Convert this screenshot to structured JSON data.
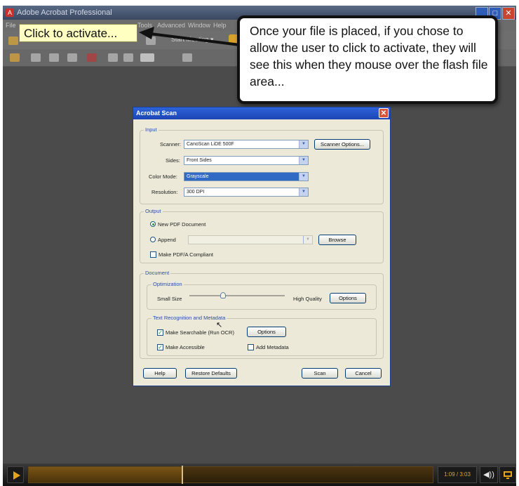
{
  "window": {
    "title": "Adobe Acrobat Professional",
    "icon": "acrobat-icon",
    "controls": [
      "_",
      "□",
      "✕"
    ]
  },
  "menu": {
    "items": [
      "File",
      "Tools",
      "Advanced",
      "Window",
      "Help"
    ],
    "meeting_label": "Start Meeting ▾"
  },
  "tooltip": {
    "text": "Click to activate..."
  },
  "callout": {
    "text": "Once your file is placed, if you chose to allow the user to click to activate, they will see this when they mouse over the flash file area..."
  },
  "dialog": {
    "title": "Acrobat Scan",
    "input": {
      "group_label": "Input",
      "scanner_label": "Scanner:",
      "scanner_value": "CanoScan LiDE 500F",
      "scanner_options_button": "Scanner Options...",
      "sides_label": "Sides:",
      "sides_value": "Front Sides",
      "color_mode_label": "Color Mode:",
      "color_mode_value": "Grayscale",
      "resolution_label": "Resolution:",
      "resolution_value": "300 DPI"
    },
    "output": {
      "group_label": "Output",
      "new_pdf_label": "New PDF Document",
      "append_label": "Append",
      "append_value": "",
      "browse_button": "Browse",
      "pdfa_label": "Make PDF/A Compliant"
    },
    "document": {
      "group_label": "Document",
      "optimization_label": "Optimization",
      "small_size_label": "Small Size",
      "high_quality_label": "High Quality",
      "optimization_options_button": "Options",
      "optimization_level": 0.35,
      "text_recognition_label": "Text Recognition and Metadata",
      "make_searchable_label": "Make Searchable (Run OCR)",
      "make_searchable_checked": true,
      "ocr_options_button": "Options",
      "make_accessible_label": "Make Accessible",
      "make_accessible_checked": true,
      "add_metadata_label": "Add Metadata",
      "add_metadata_checked": false
    },
    "buttons": {
      "help": "Help",
      "restore_defaults": "Restore Defaults",
      "scan": "Scan",
      "cancel": "Cancel"
    }
  },
  "player": {
    "timecode": "1:09 / 3:03",
    "progress_fraction": 0.38,
    "volume_icon": "◀))"
  }
}
